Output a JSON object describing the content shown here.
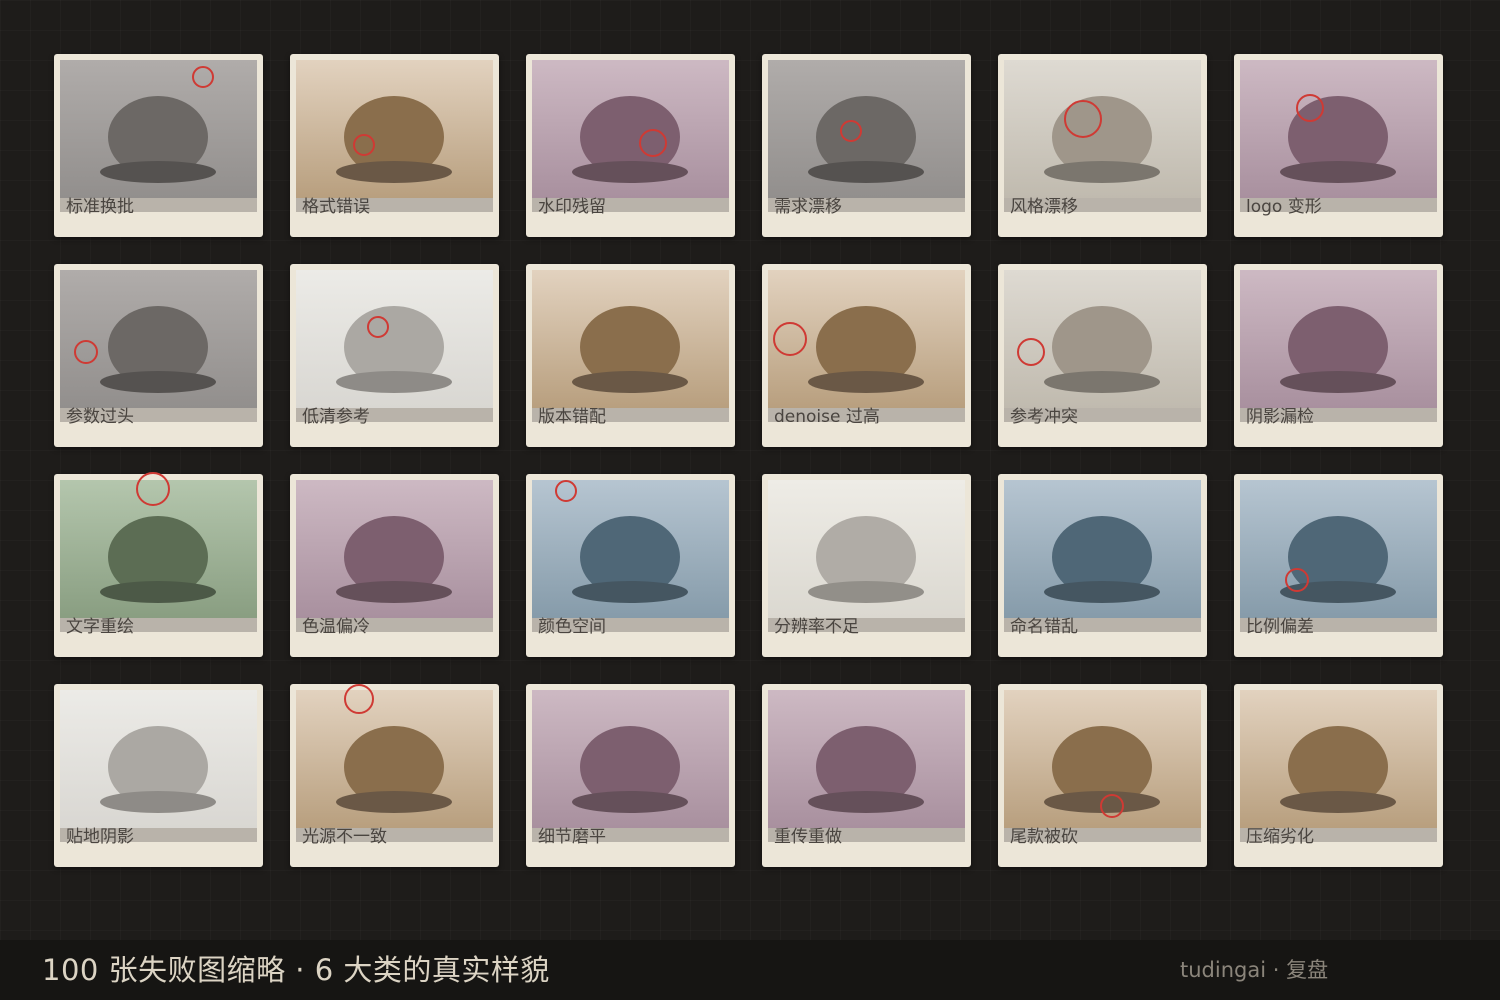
{
  "palettes": {
    "gray": {
      "bg_top": "#b0acaa",
      "bg_bottom": "#8f8c8a",
      "dome": "#6c6865",
      "shadow": "#555250"
    },
    "tan": {
      "bg_top": "#e2d2bf",
      "bg_bottom": "#b49a78",
      "dome": "#8a6e4c",
      "shadow": "#6a5846"
    },
    "mauve": {
      "bg_top": "#cdb9c3",
      "bg_bottom": "#a58c9b",
      "dome": "#7d5f6f",
      "shadow": "#65505a"
    },
    "beige": {
      "bg_top": "#dedad2",
      "bg_bottom": "#bdb7ab",
      "dome": "#9f968a",
      "shadow": "#7b766e"
    },
    "light": {
      "bg_top": "#ecebe7",
      "bg_bottom": "#d7d5d0",
      "dome": "#aba8a3",
      "shadow": "#8e8b87"
    },
    "green": {
      "bg_top": "#b4c6ad",
      "bg_bottom": "#859a7d",
      "dome": "#5c6d54",
      "shadow": "#4c5947"
    },
    "blue": {
      "bg_top": "#b6c5d1",
      "bg_bottom": "#8197a6",
      "dome": "#4f6777",
      "shadow": "#455661"
    },
    "cream": {
      "bg_top": "#eeece6",
      "bg_bottom": "#d9d6ce",
      "dome": "#b0aca6",
      "shadow": "#928f89"
    }
  },
  "thumbnails": [
    {
      "label": "标准换批",
      "palette": "gray"
    },
    {
      "label": "格式错误",
      "palette": "tan"
    },
    {
      "label": "水印残留",
      "palette": "mauve"
    },
    {
      "label": "需求漂移",
      "palette": "gray"
    },
    {
      "label": "风格漂移",
      "palette": "beige"
    },
    {
      "label": "logo 变形",
      "palette": "mauve"
    },
    {
      "label": "参数过头",
      "palette": "gray"
    },
    {
      "label": "低清参考",
      "palette": "light"
    },
    {
      "label": "版本错配",
      "palette": "tan"
    },
    {
      "label": "denoise 过高",
      "palette": "tan"
    },
    {
      "label": "参考冲突",
      "palette": "beige"
    },
    {
      "label": "阴影漏检",
      "palette": "mauve"
    },
    {
      "label": "文字重绘",
      "palette": "green"
    },
    {
      "label": "色温偏冷",
      "palette": "mauve"
    },
    {
      "label": "颜色空间",
      "palette": "blue"
    },
    {
      "label": "分辨率不足",
      "palette": "cream"
    },
    {
      "label": "命名错乱",
      "palette": "blue"
    },
    {
      "label": "比例偏差",
      "palette": "blue"
    },
    {
      "label": "贴地阴影",
      "palette": "light"
    },
    {
      "label": "光源不一致",
      "palette": "tan"
    },
    {
      "label": "细节磨平",
      "palette": "mauve"
    },
    {
      "label": "重传重做",
      "palette": "mauve"
    },
    {
      "label": "尾款被砍",
      "palette": "tan"
    },
    {
      "label": "压缩劣化",
      "palette": "tan"
    }
  ],
  "marker_color": "#cf3a34",
  "footer": {
    "title": "100 张失败图缩略 · 6 大类的真实样貌",
    "brand": "tudingai · 复盘"
  }
}
